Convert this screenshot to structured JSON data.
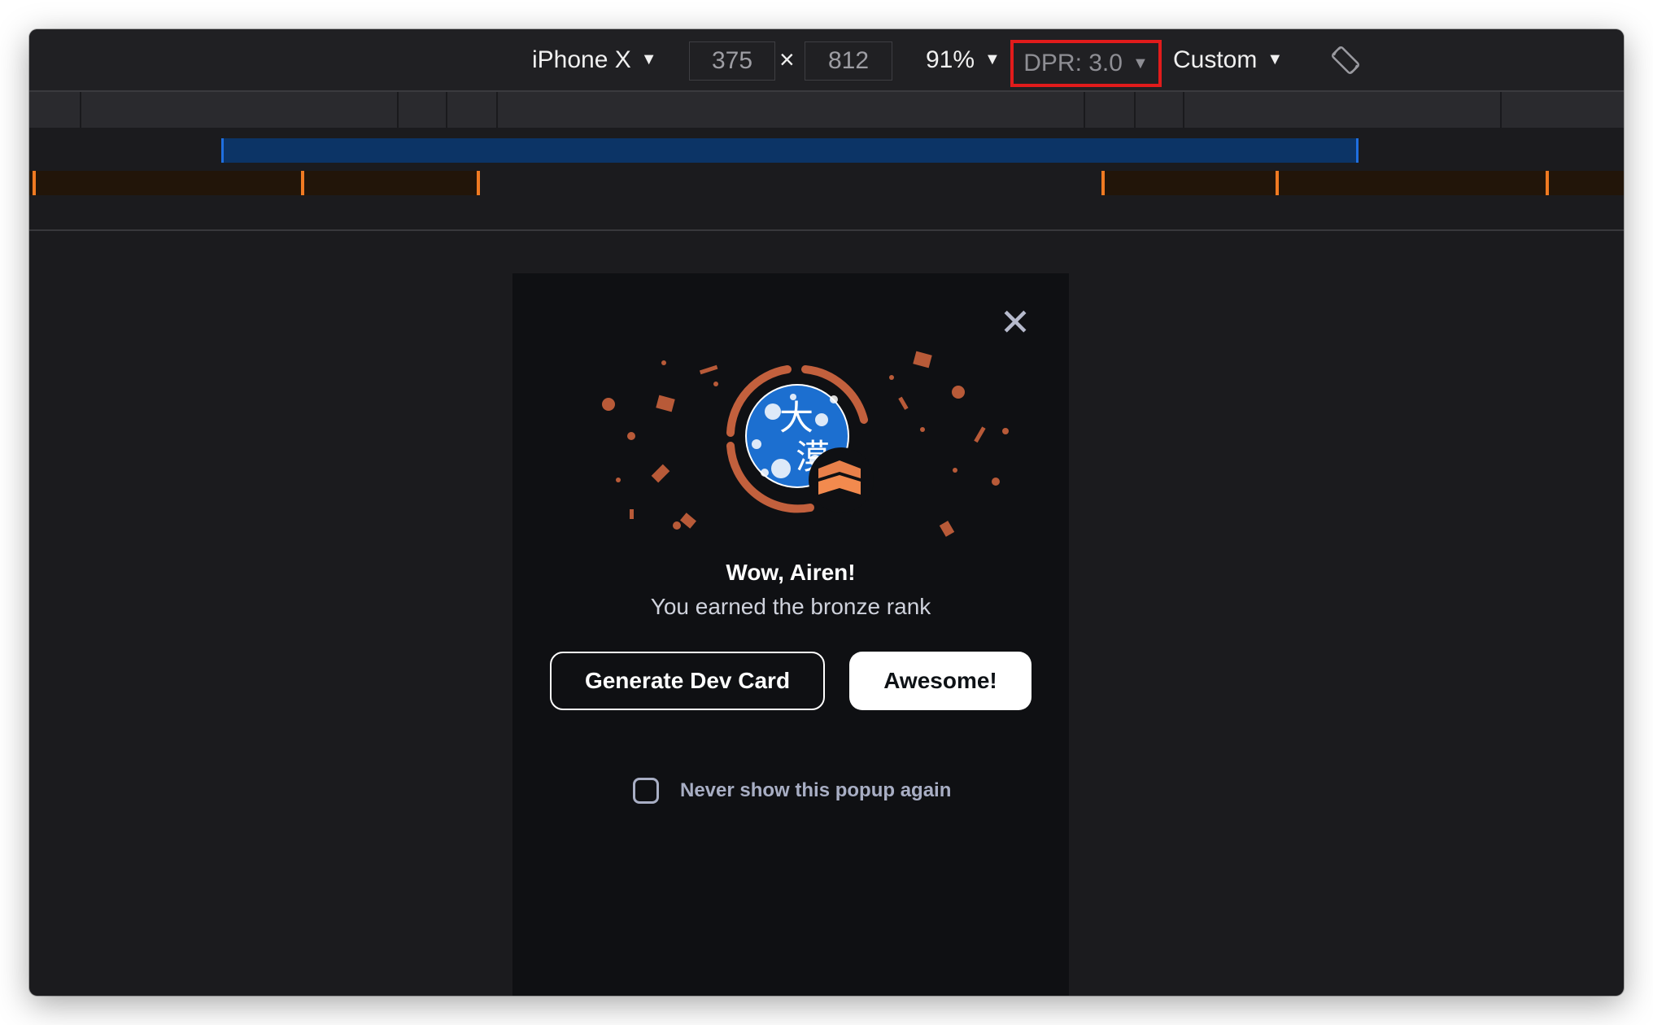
{
  "toolbar": {
    "device": "iPhone X",
    "width_value": "375",
    "times": "×",
    "height_value": "812",
    "zoom": "91%",
    "dpr": "DPR: 3.0",
    "throttle": "Custom",
    "dropdown_arrow": "▼",
    "rotate_icon": "rotate-device-icon"
  },
  "colors": {
    "highlight_border": "#e11b1b",
    "media_query_blue": "#0c3466",
    "media_query_orange": "#f07a22",
    "bronze_accent": "#c2603d"
  },
  "popup": {
    "close_icon": "close-icon",
    "avatar_icon": "user-avatar",
    "rank_badge_icon": "bronze-rank-badge-icon",
    "avatar_text_1": "大",
    "avatar_text_2": "漠",
    "title": "Wow, Airen!",
    "subtitle": "You earned the bronze rank",
    "generate_button": "Generate Dev Card",
    "awesome_button": "Awesome!",
    "checkbox_label": "Never show this popup again",
    "checkbox_checked": false
  }
}
